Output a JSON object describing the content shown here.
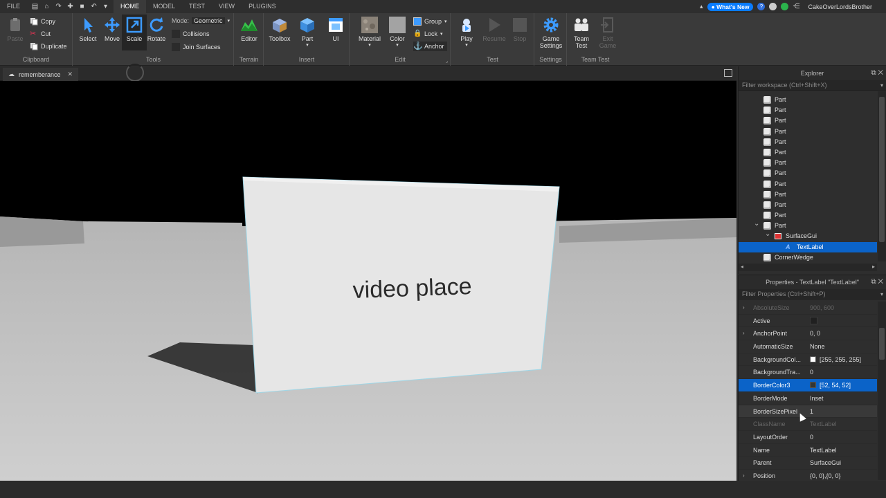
{
  "menu": {
    "file": "FILE",
    "tabs": [
      "HOME",
      "MODEL",
      "TEST",
      "VIEW",
      "PLUGINS"
    ],
    "active_tab": "HOME",
    "whats_new": "What's New",
    "username": "CakeOverLordsBrother"
  },
  "ribbon": {
    "clipboard": {
      "paste": "Paste",
      "copy": "Copy",
      "cut": "Cut",
      "duplicate": "Duplicate",
      "label": "Clipboard"
    },
    "tools": {
      "select": "Select",
      "move": "Move",
      "scale": "Scale",
      "rotate": "Rotate",
      "mode_label": "Mode:",
      "mode_value": "Geometric",
      "collisions": "Collisions",
      "join_surfaces": "Join Surfaces",
      "label": "Tools"
    },
    "terrain": {
      "editor": "Editor",
      "label": "Terrain"
    },
    "insert": {
      "toolbox": "Toolbox",
      "part": "Part",
      "ui": "UI",
      "label": "Insert"
    },
    "edit": {
      "material": "Material",
      "color": "Color",
      "group": "Group",
      "lock": "Lock",
      "anchor": "Anchor",
      "label": "Edit"
    },
    "test": {
      "play": "Play",
      "resume": "Resume",
      "stop": "Stop",
      "label": "Test"
    },
    "settings": {
      "game_settings_1": "Game",
      "game_settings_2": "Settings",
      "label": "Settings"
    },
    "team_test": {
      "team_test_1": "Team",
      "team_test_2": "Test",
      "exit_game_1": "Exit",
      "exit_game_2": "Game",
      "label": "Team Test"
    }
  },
  "viewport": {
    "tab_name": "rememberance",
    "sign_text": "video place"
  },
  "explorer": {
    "title": "Explorer",
    "filter_placeholder": "Filter workspace (Ctrl+Shift+X)",
    "items": [
      {
        "label": "Part",
        "level": 0
      },
      {
        "label": "Part",
        "level": 0
      },
      {
        "label": "Part",
        "level": 0
      },
      {
        "label": "Part",
        "level": 0
      },
      {
        "label": "Part",
        "level": 0
      },
      {
        "label": "Part",
        "level": 0
      },
      {
        "label": "Part",
        "level": 0
      },
      {
        "label": "Part",
        "level": 0
      },
      {
        "label": "Part",
        "level": 0
      },
      {
        "label": "Part",
        "level": 0
      },
      {
        "label": "Part",
        "level": 0
      },
      {
        "label": "Part",
        "level": 0
      },
      {
        "label": "Part",
        "level": 0,
        "expanded": true
      },
      {
        "label": "SurfaceGui",
        "level": 1,
        "expanded": true
      },
      {
        "label": "TextLabel",
        "level": 2,
        "selected": true
      },
      {
        "label": "CornerWedge",
        "level": 0
      }
    ]
  },
  "properties": {
    "title": "Properties - TextLabel \"TextLabel\"",
    "filter_placeholder": "Filter Properties (Ctrl+Shift+P)",
    "rows": [
      {
        "name": "AbsoluteSize",
        "value": "900, 600",
        "expandable": true,
        "dim": true
      },
      {
        "name": "Active",
        "value": "",
        "checkbox": true
      },
      {
        "name": "AnchorPoint",
        "value": "0, 0",
        "expandable": true
      },
      {
        "name": "AutomaticSize",
        "value": "None"
      },
      {
        "name": "BackgroundCol...",
        "value": "[255, 255, 255]",
        "swatch": "#ffffff"
      },
      {
        "name": "BackgroundTra...",
        "value": "0"
      },
      {
        "name": "BorderColor3",
        "value": "[52, 54, 52]",
        "swatch": "#343634",
        "selected": true
      },
      {
        "name": "BorderMode",
        "value": "Inset"
      },
      {
        "name": "BorderSizePixel",
        "value": "1",
        "hover": true
      },
      {
        "name": "ClassName",
        "value": "TextLabel",
        "dim": true
      },
      {
        "name": "LayoutOrder",
        "value": "0"
      },
      {
        "name": "Name",
        "value": "TextLabel"
      },
      {
        "name": "Parent",
        "value": "SurfaceGui"
      },
      {
        "name": "Position",
        "value": "{0, 0},{0, 0}",
        "expandable": true
      }
    ]
  }
}
